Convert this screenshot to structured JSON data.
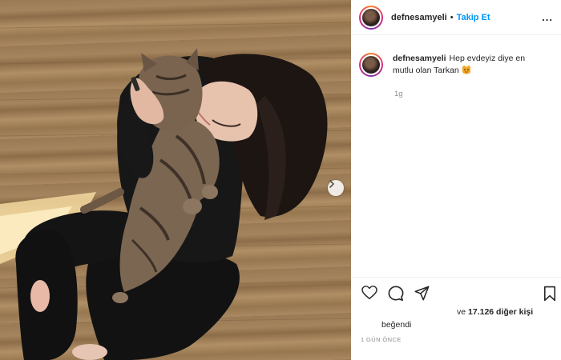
{
  "post": {
    "username": "defnesamyeli",
    "separator": "•",
    "follow_label": "Takip Et",
    "more_label": "...",
    "caption_user": "defnesamyeli",
    "caption_text": "Hep evdeyiz diye en mutlu olan Tarkan",
    "caption_emoji": "cat-face-icon",
    "relative_time": "1g",
    "likes_prefix": "ve",
    "likes_count": "17.126 diğer kişi",
    "likes_suffix": "beğendi",
    "timestamp": "1 GÜN ÖNCE"
  },
  "icons": {
    "like": "heart-icon",
    "comment": "comment-icon",
    "share": "send-icon",
    "save": "bookmark-icon",
    "next": "chevron-right-icon"
  },
  "colors": {
    "follow_blue": "#0095f6",
    "text": "#262626",
    "muted": "#8e8e8e",
    "border": "#efefef"
  }
}
